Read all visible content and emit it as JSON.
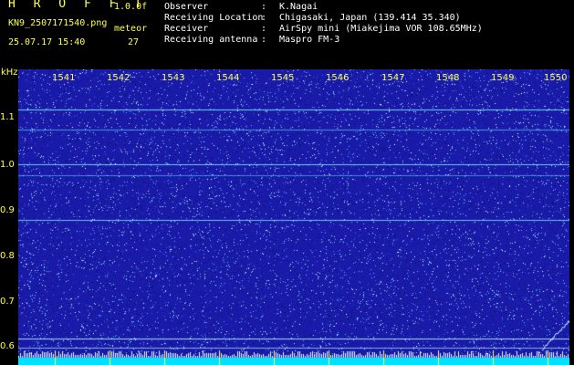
{
  "header": {
    "brand": "H R O F F T",
    "version": "1.0.0f",
    "filename": "KN9_2507171540.png",
    "meteor_label": "meteor",
    "datetime": "25.07.17 15:40",
    "meteor_count": "27",
    "info": [
      {
        "label": "Observer",
        "value": "K.Nagai"
      },
      {
        "label": "Receiving Location",
        "value": "Chigasaki, Japan (139.414 35.340)"
      },
      {
        "label": "Receiver",
        "value": "AirSpy mini (Miakejima VOR 108.65MHz)"
      },
      {
        "label": "Receiving antenna",
        "value": "Maspro FM-3"
      }
    ],
    "colon": ":"
  },
  "axis": {
    "y_unit": "kHz",
    "y_ticks": [
      "1.1",
      "1.0",
      "0.9",
      "0.8",
      "0.7",
      "0.6"
    ],
    "x_ticks": [
      "1541",
      "1542",
      "1543",
      "1544",
      "1545",
      "1546",
      "1547",
      "1548",
      "1549",
      "1550"
    ]
  },
  "colors": {
    "background": "#000000",
    "text": "#ffff55",
    "waterfall": "#1a1aa8",
    "noise": "#6fd0ff",
    "baseline": "#00e0ff"
  }
}
